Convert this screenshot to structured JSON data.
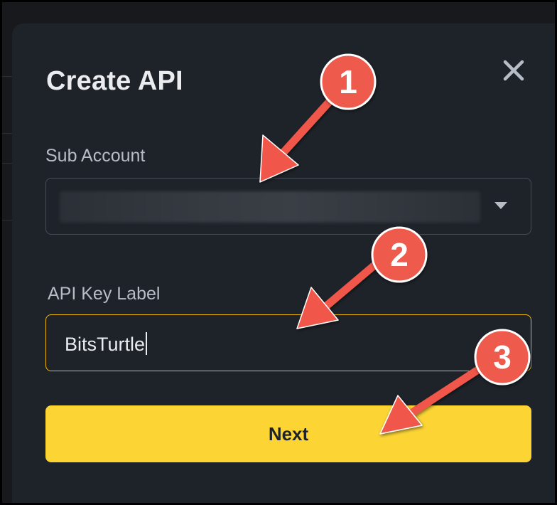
{
  "modal": {
    "title": "Create API",
    "close_icon": "close-icon"
  },
  "sub_account": {
    "label": "Sub Account",
    "value": "",
    "dropdown_icon": "caret-down-icon"
  },
  "api_key_label": {
    "label": "API Key Label",
    "value": "BitsTurtle"
  },
  "next_button": {
    "label": "Next"
  },
  "annotations": {
    "step_1": "1",
    "step_2": "2",
    "step_3": "3",
    "badge_color": "#ee5a4c",
    "arrow_color": "#f0574a"
  },
  "colors": {
    "modal_bg": "#1e2329",
    "accent_yellow": "#fcd535",
    "focus_border": "#f0b90b",
    "text_primary": "#eaecef",
    "text_secondary": "#b7bdc6"
  }
}
